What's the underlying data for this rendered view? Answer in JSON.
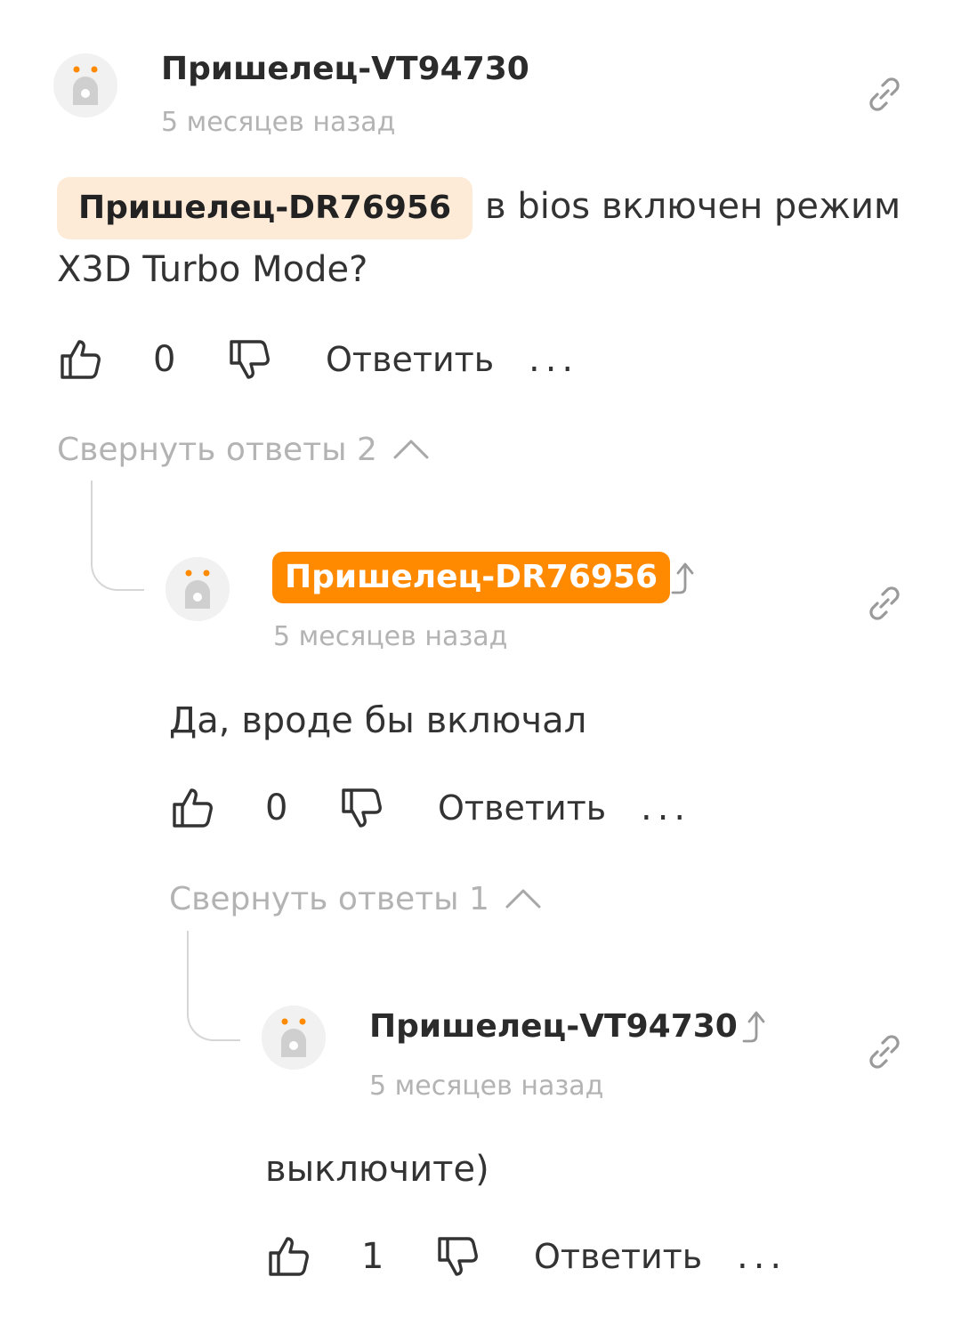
{
  "colors": {
    "accent": "#ff8a00",
    "mention_bg": "#fdebd8",
    "muted": "#b3b3b3",
    "text": "#333333"
  },
  "comments": [
    {
      "author": "Пришелец-VT94730",
      "time": "5 месяцев назад",
      "mention": "Пришелец-DR76956",
      "text": "в bios включен режим X3D Turbo Mode?",
      "likes": "0",
      "reply_label": "Ответить",
      "more": "...",
      "collapse_label": "Свернуть ответы 2",
      "icons": [
        "avatar-icon",
        "link-icon",
        "thumb-up-icon",
        "thumb-down-icon",
        "chevron-up-icon"
      ]
    },
    {
      "author": "Пришелец-DR76956",
      "author_highlighted": true,
      "time": "5 месяцев назад",
      "text": "Да, вроде бы включал",
      "likes": "0",
      "reply_label": "Ответить",
      "more": "...",
      "collapse_label": "Свернуть ответы 1",
      "icons": [
        "avatar-icon",
        "reply-up-arrow-icon",
        "link-icon",
        "thumb-up-icon",
        "thumb-down-icon",
        "chevron-up-icon"
      ]
    },
    {
      "author": "Пришелец-VT94730",
      "time": "5 месяцев назад",
      "text": "выключите)",
      "likes": "1",
      "reply_label": "Ответить",
      "more": "...",
      "icons": [
        "avatar-icon",
        "reply-up-arrow-icon",
        "link-icon",
        "thumb-up-icon",
        "thumb-down-icon"
      ]
    }
  ]
}
